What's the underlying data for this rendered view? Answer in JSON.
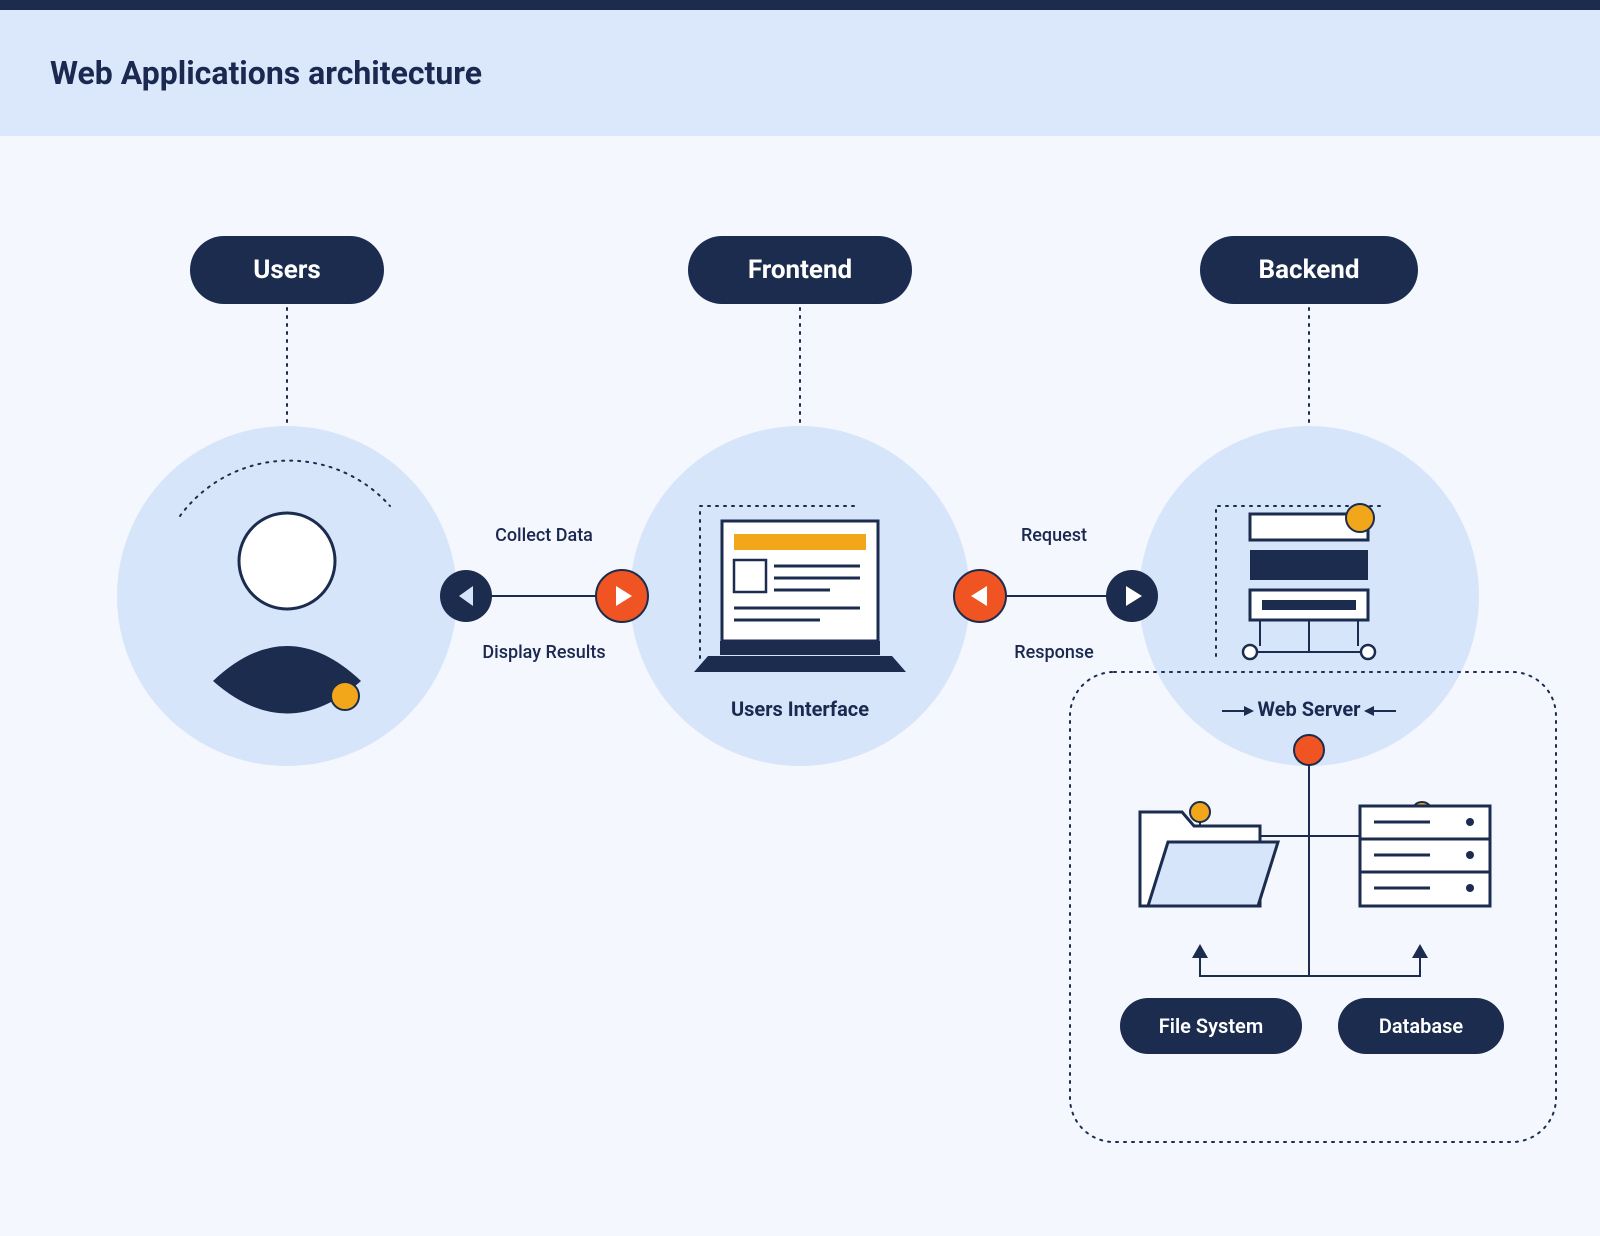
{
  "title": "Web Applications architecture",
  "nodes": {
    "users": {
      "pill": "Users"
    },
    "frontend": {
      "pill": "Frontend",
      "sub": "Users Interface"
    },
    "backend": {
      "pill": "Backend",
      "sub": "Web Server"
    }
  },
  "flows": {
    "uf_top": "Collect Data",
    "uf_bottom": "Display Results",
    "fb_top": "Request",
    "fb_bottom": "Response"
  },
  "storage": {
    "fs": "File System",
    "db": "Database"
  },
  "colors": {
    "navy": "#1b2c4f",
    "orange_fill": "#f05423",
    "amber": "#f2a71b",
    "light_blue": "#d6e5fa",
    "page_bg": "#f4f7fd",
    "header_bg": "#dbe8fb"
  }
}
